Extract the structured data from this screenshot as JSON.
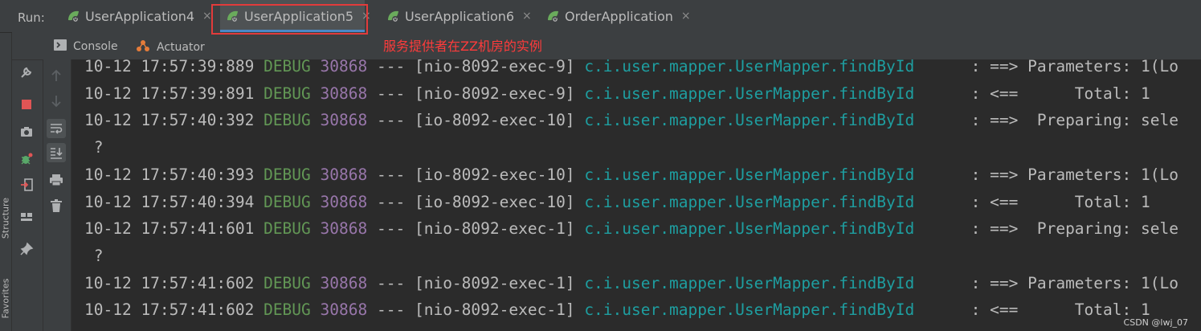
{
  "run_bar": {
    "label": "Run:",
    "tabs": [
      {
        "label": "UserApplication4",
        "close": "×",
        "active": false
      },
      {
        "label": "UserApplication5",
        "close": "×",
        "active": true
      },
      {
        "label": "UserApplication6",
        "close": "×",
        "active": false
      },
      {
        "label": "OrderApplication",
        "close": "×",
        "active": false
      }
    ],
    "annotation": "服务提供者在ZZ机房的实例"
  },
  "sub_tabs": [
    {
      "label": "Console",
      "icon": "console-icon"
    },
    {
      "label": "Actuator",
      "icon": "actuator-icon"
    }
  ],
  "side_labels": {
    "structure": "Structure",
    "favorites": "Favorites"
  },
  "console_lines": [
    {
      "ts": "10-12 17:57:39:889",
      "level": "DEBUG",
      "pid": "30868",
      "sep": "---",
      "thread": "[nio-8092-exec-9]",
      "logger": "c.i.user.mapper.UserMapper.findById",
      "msg": ": ==> Parameters: 1(Lo"
    },
    {
      "ts": "10-12 17:57:39:891",
      "level": "DEBUG",
      "pid": "30868",
      "sep": "---",
      "thread": "[nio-8092-exec-9]",
      "logger": "c.i.user.mapper.UserMapper.findById",
      "msg": ": <==      Total: 1"
    },
    {
      "ts": "10-12 17:57:40:392",
      "level": "DEBUG",
      "pid": "30868",
      "sep": "---",
      "thread": "[io-8092-exec-10]",
      "logger": "c.i.user.mapper.UserMapper.findById",
      "msg": ": ==>  Preparing: sele"
    },
    {
      "text": "?"
    },
    {
      "ts": "10-12 17:57:40:393",
      "level": "DEBUG",
      "pid": "30868",
      "sep": "---",
      "thread": "[io-8092-exec-10]",
      "logger": "c.i.user.mapper.UserMapper.findById",
      "msg": ": ==> Parameters: 1(Lo"
    },
    {
      "ts": "10-12 17:57:40:394",
      "level": "DEBUG",
      "pid": "30868",
      "sep": "---",
      "thread": "[io-8092-exec-10]",
      "logger": "c.i.user.mapper.UserMapper.findById",
      "msg": ": <==      Total: 1"
    },
    {
      "ts": "10-12 17:57:41:601",
      "level": "DEBUG",
      "pid": "30868",
      "sep": "---",
      "thread": "[nio-8092-exec-1]",
      "logger": "c.i.user.mapper.UserMapper.findById",
      "msg": ": ==>  Preparing: sele"
    },
    {
      "text": "?"
    },
    {
      "ts": "10-12 17:57:41:602",
      "level": "DEBUG",
      "pid": "30868",
      "sep": "---",
      "thread": "[nio-8092-exec-1]",
      "logger": "c.i.user.mapper.UserMapper.findById",
      "msg": ": ==> Parameters: 1(Lo"
    },
    {
      "ts": "10-12 17:57:41:602",
      "level": "DEBUG",
      "pid": "30868",
      "sep": "---",
      "thread": "[nio-8092-exec-1]",
      "logger": "c.i.user.mapper.UserMapper.findById",
      "msg": ": <==      Total: 1"
    }
  ],
  "watermark": "CSDN @lwj_07",
  "colors": {
    "background": "#2b2b2b",
    "level_debug": "#629755",
    "pid": "#9876aa",
    "logger": "#1e9ea0",
    "annotation": "#ff3b3b",
    "highlight_border": "#e23b3b",
    "active_tab_underline": "#4a88c7"
  }
}
